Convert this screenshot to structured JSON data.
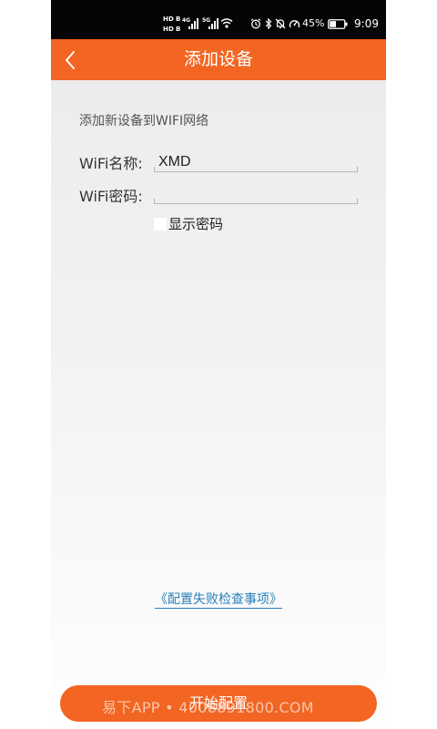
{
  "status_bar": {
    "hd_label": "HD",
    "b_label": "B",
    "network_4g": "4G",
    "network_5g": "5G",
    "battery_percent": "45%",
    "battery_level": 0.45,
    "time": "9:09"
  },
  "header": {
    "title": "添加设备",
    "back_icon": "chevron-left-icon"
  },
  "form": {
    "intro": "添加新设备到WIFI网络",
    "wifi_name_label": "WiFi名称:",
    "wifi_name_value": "XMD",
    "wifi_password_label": "WiFi密码:",
    "wifi_password_value": "",
    "show_password_label": "显示密码",
    "show_password_checked": false
  },
  "help_link": "《配置失败检查事项》",
  "start_button": "开始配置",
  "watermark": "易下APP • 4008891800.COM",
  "colors": {
    "accent": "#f26522",
    "link": "#2a7fb8",
    "status_bar": "#050505"
  }
}
